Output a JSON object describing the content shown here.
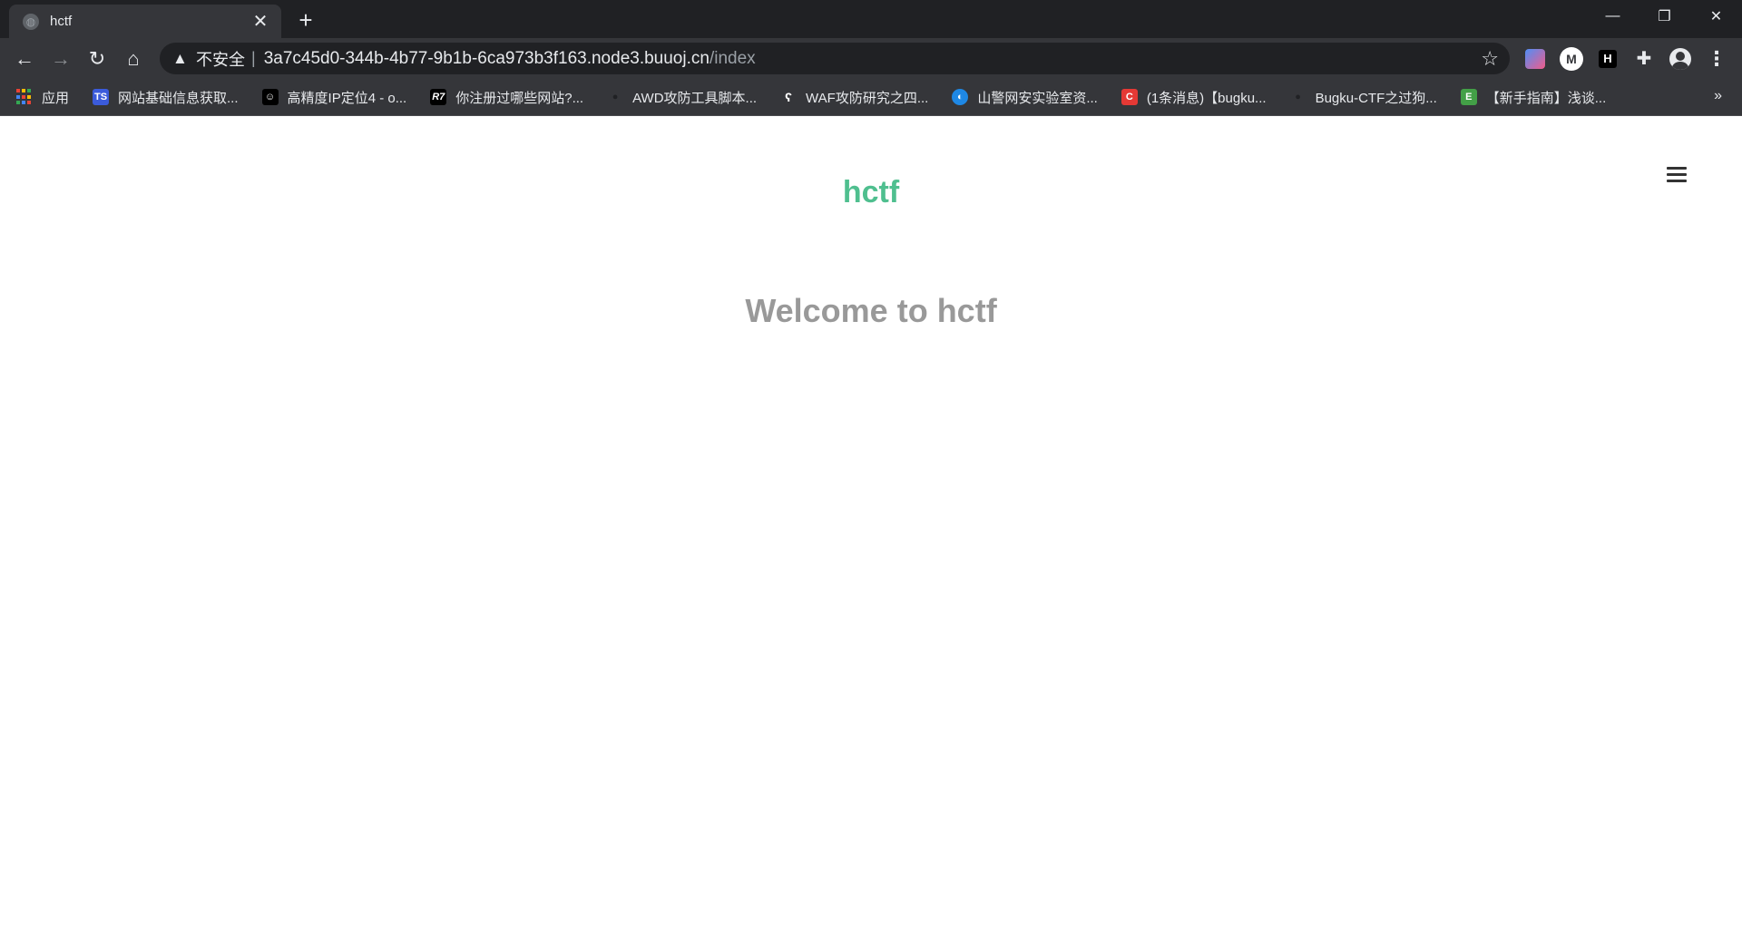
{
  "browser": {
    "tab": {
      "title": "hctf",
      "close_glyph": "✕"
    },
    "new_tab_glyph": "+",
    "window_controls": {
      "minimize": "—",
      "restore": "❐",
      "close": "✕"
    },
    "nav": {
      "back": "←",
      "forward": "→",
      "reload": "↻",
      "home": "⌂"
    },
    "omnibox": {
      "security_label": "不安全",
      "separator": "|",
      "url_host": "3a7c45d0-344b-4b77-9b1b-6ca973b3f163.node3.buuoj.cn",
      "url_path": "/index",
      "star": "☆"
    },
    "extensions": {
      "puzzle": "✚",
      "menu": "⋮",
      "ext2_letter": "M",
      "ext3_letter": "H"
    }
  },
  "bookmarks": {
    "items": [
      {
        "label": "应用",
        "icon": "apps-grid-icon"
      },
      {
        "label": "网站基础信息获取...",
        "icon": "ts-icon",
        "icon_text": "TS",
        "color": "#3b5bdb"
      },
      {
        "label": "高精度IP定位4 - o...",
        "icon": "octocat-icon",
        "icon_text": "☺",
        "color": "#000000"
      },
      {
        "label": "你注册过哪些网站?...",
        "icon": "r7-icon",
        "icon_text": "R7",
        "color": "#000000"
      },
      {
        "label": "AWD攻防工具脚本...",
        "icon": "github-icon",
        "icon_text": "●",
        "color": "#35363a"
      },
      {
        "label": "WAF攻防研究之四...",
        "icon": "blog-icon",
        "icon_text": "ʕ",
        "color": "#35363a"
      },
      {
        "label": "山警网安实验室资...",
        "icon": "lab-icon",
        "icon_text": "◐",
        "color": "#1e88e5"
      },
      {
        "label": "(1条消息)【bugku...",
        "icon": "csdn-icon",
        "icon_text": "C",
        "color": "#e53935"
      },
      {
        "label": "Bugku-CTF之过狗...",
        "icon": "github-icon",
        "icon_text": "●",
        "color": "#35363a"
      },
      {
        "label": "【新手指南】浅谈...",
        "icon": "guide-icon",
        "icon_text": "E",
        "color": "#43a047"
      }
    ],
    "more": "»"
  },
  "page": {
    "brand": "hctf",
    "heading": "Welcome to hctf",
    "colors": {
      "brand": "#4fbf8f",
      "heading": "#999999"
    }
  }
}
